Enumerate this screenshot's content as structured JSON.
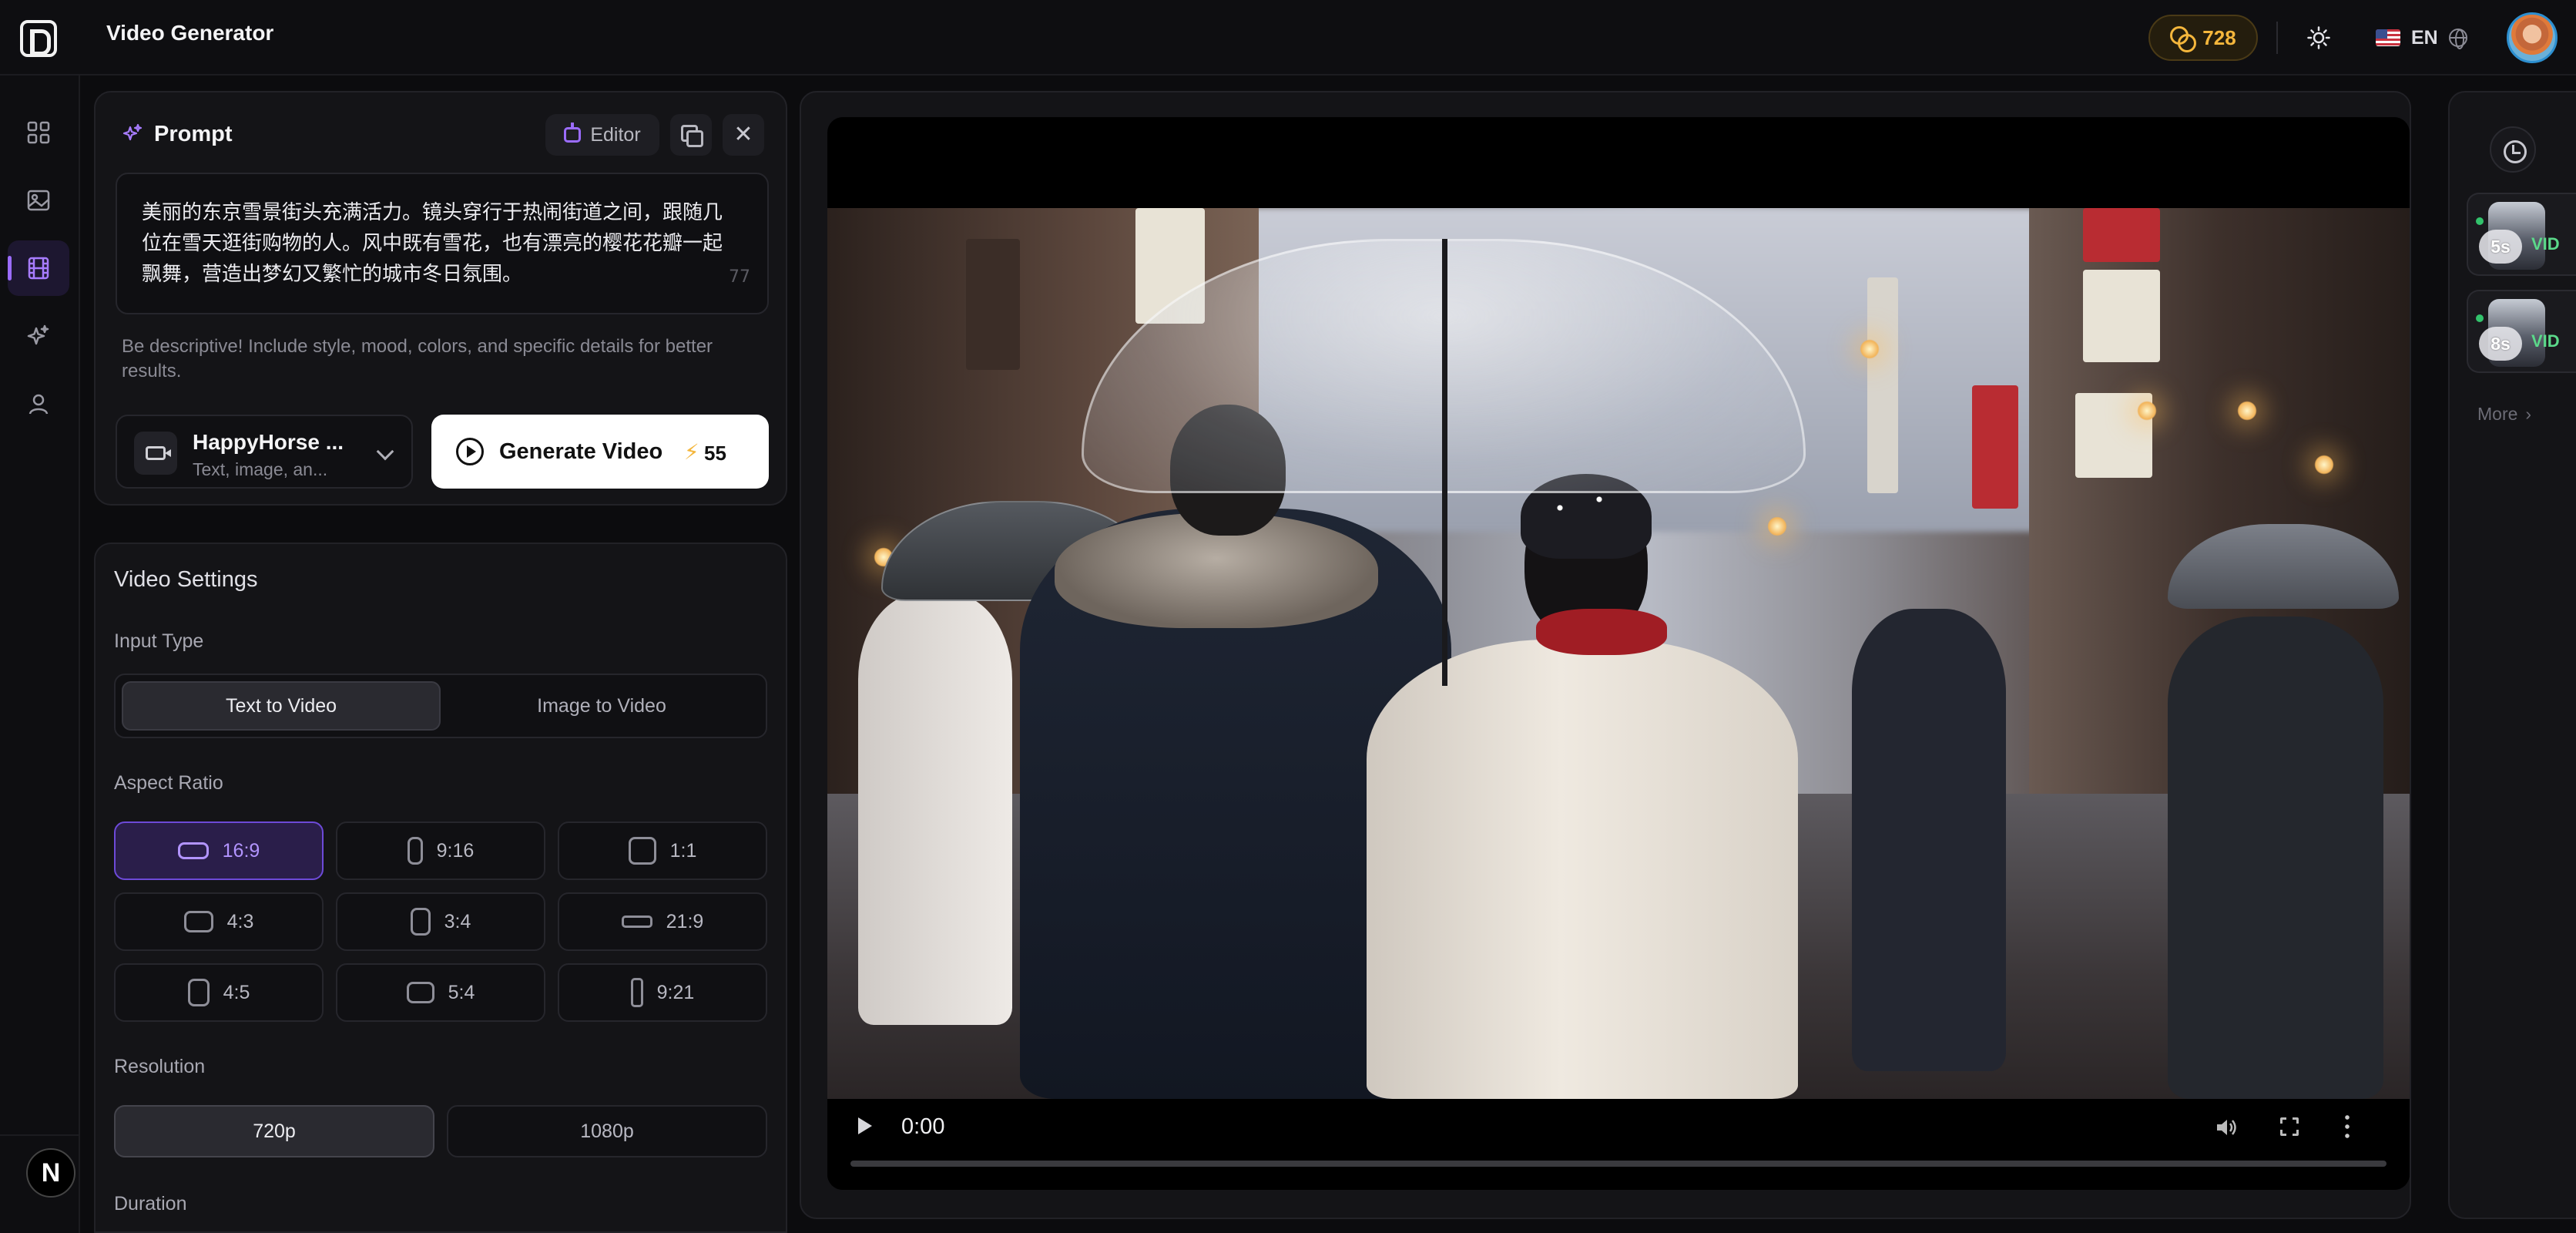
{
  "header": {
    "app_title": "Video Generator",
    "credits": "728",
    "language": "EN",
    "icons": [
      "app-logo",
      "coin-icon",
      "sun-icon",
      "us-flag",
      "globe-icon",
      "user-avatar"
    ]
  },
  "nav": {
    "items": [
      {
        "name": "dashboard",
        "icon": "grid-icon",
        "active": false
      },
      {
        "name": "image",
        "icon": "image-icon",
        "active": false
      },
      {
        "name": "video",
        "icon": "film-icon",
        "active": true
      },
      {
        "name": "effects",
        "icon": "sparkle-icon",
        "active": false
      },
      {
        "name": "profile",
        "icon": "user-icon",
        "active": false
      }
    ],
    "badge": "N"
  },
  "prompt": {
    "title": "Prompt",
    "editor_label": "Editor",
    "text": "美丽的东京雪景街头充满活力。镜头穿行于热闹街道之间，跟随几位在雪天逛街购物的人。风中既有雪花，也有漂亮的樱花花瓣一起飘舞，营造出梦幻又繁忙的城市冬日氛围。",
    "char_count": "77",
    "hint": "Be descriptive! Include style, mood, colors, and specific details for better results.",
    "model_name": "HappyHorse ...",
    "model_sub": "Text, image, an...",
    "generate_label": "Generate Video",
    "generate_cost": "55"
  },
  "settings": {
    "title": "Video Settings",
    "input_type_label": "Input Type",
    "input_types": [
      "Text to Video",
      "Image to Video"
    ],
    "input_type_selected": "Text to Video",
    "aspect_ratio_label": "Aspect Ratio",
    "aspect_ratios": [
      "16:9",
      "9:16",
      "1:1",
      "4:3",
      "3:4",
      "21:9",
      "4:5",
      "5:4",
      "9:21"
    ],
    "aspect_ratio_selected": "16:9",
    "resolution_label": "Resolution",
    "resolutions": [
      "720p",
      "1080p"
    ],
    "resolution_selected": "720p",
    "duration_label": "Duration"
  },
  "player": {
    "time": "0:00",
    "progress": 0,
    "colors": {
      "accent": "#9b6cff",
      "credit": "#f4b63c",
      "status_ok": "#32c36c"
    }
  },
  "history": {
    "items": [
      {
        "duration": "5s",
        "tag": "VID"
      },
      {
        "duration": "8s",
        "tag": "VID"
      }
    ],
    "more_label": "More"
  }
}
